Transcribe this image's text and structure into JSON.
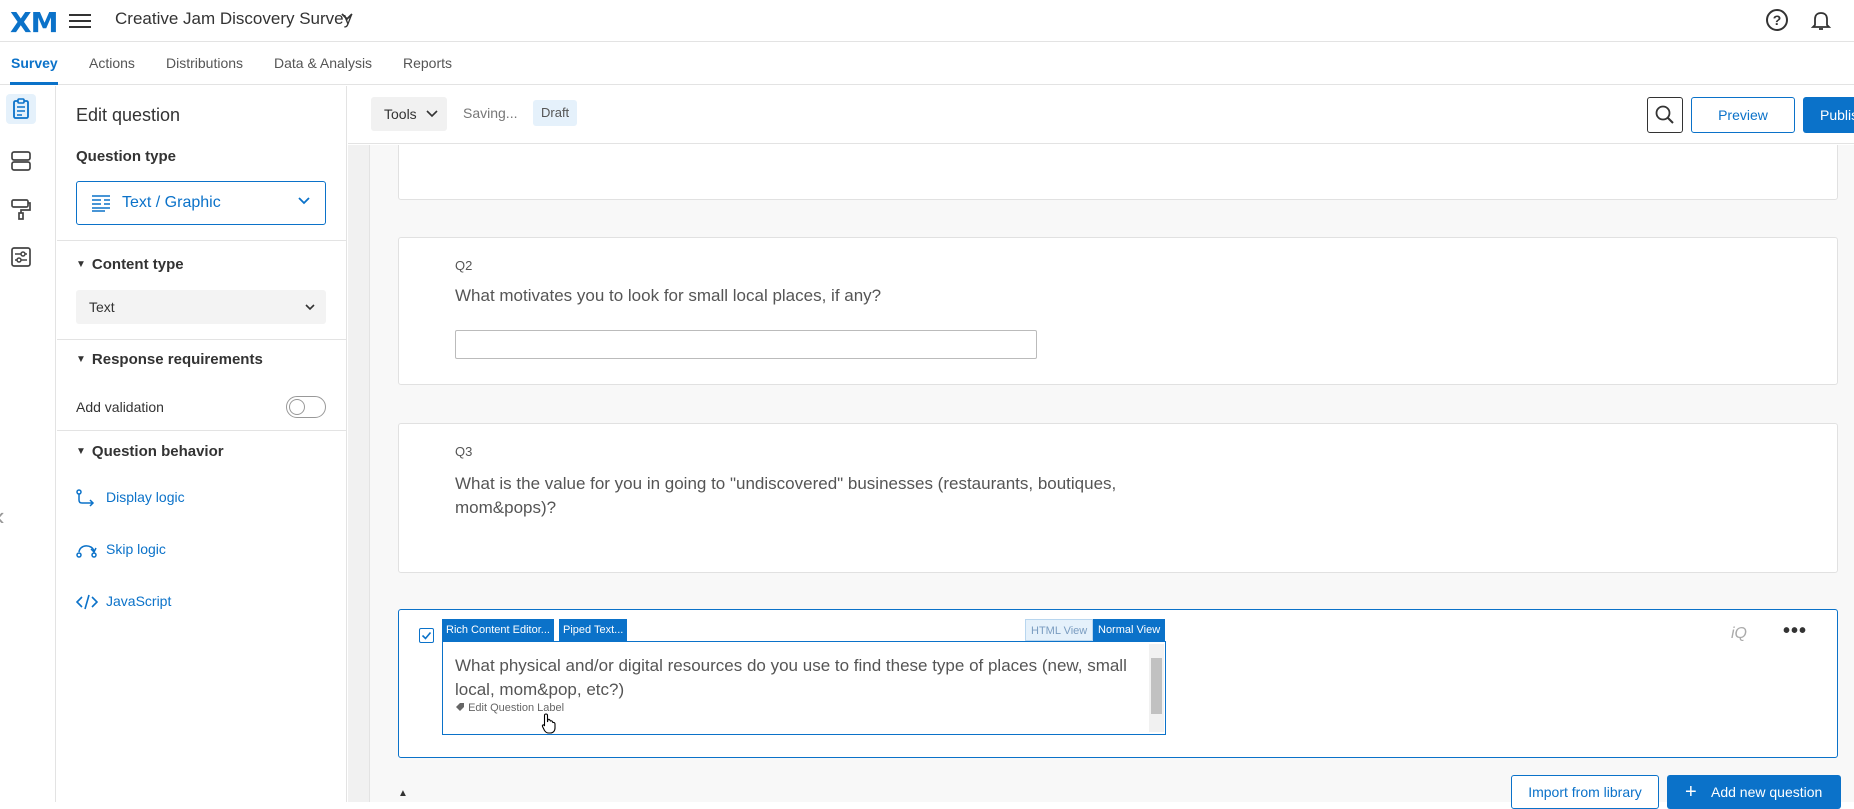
{
  "topbar": {
    "logo": "XM",
    "survey_title": "Creative Jam Discovery Survey"
  },
  "nav": {
    "tabs": [
      "Survey",
      "Actions",
      "Distributions",
      "Data & Analysis",
      "Reports"
    ],
    "active": "Survey"
  },
  "edit_panel": {
    "title": "Edit question",
    "question_type_label": "Question type",
    "question_type_value": "Text / Graphic",
    "content_type_label": "Content type",
    "content_type_value": "Text",
    "response_requirements_label": "Response requirements",
    "add_validation_label": "Add validation",
    "add_validation_on": false,
    "question_behavior_label": "Question behavior",
    "behavior_items": [
      "Display logic",
      "Skip logic",
      "JavaScript"
    ]
  },
  "toolbar": {
    "tools_label": "Tools",
    "status_text": "Saving...",
    "draft_badge": "Draft",
    "preview_label": "Preview",
    "publish_label": "Publish"
  },
  "questions": [
    {
      "id": "Q2",
      "text": "What motivates you to look for small local places, if any?"
    },
    {
      "id": "Q3",
      "text": "What is the value for you in going to \"undiscovered\" businesses (restaurants, boutiques, mom&pops)?"
    }
  ],
  "active_question": {
    "rich_editor_label": "Rich Content Editor...",
    "piped_text_label": "Piped Text...",
    "html_view_label": "HTML View",
    "normal_view_label": "Normal View",
    "text": "What physical and/or digital resources do you use to find these type of places (new, small local, mom&pop, etc?)",
    "edit_label": "Edit Question Label",
    "iq_label": "iQ",
    "more_label": "•••"
  },
  "footer": {
    "import_label": "Import from library",
    "add_label": "Add new question"
  },
  "colors": {
    "accent": "#0b72c9",
    "text": "#333333",
    "muted": "#555555"
  }
}
